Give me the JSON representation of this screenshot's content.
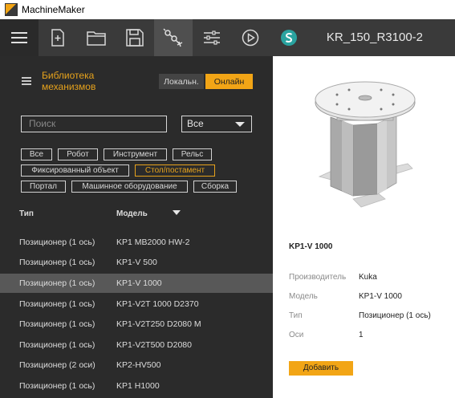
{
  "app": {
    "title": "MachineMaker"
  },
  "toolbar": {
    "buttons": [
      {
        "icon": "menu-icon"
      },
      {
        "icon": "new-document-icon"
      },
      {
        "icon": "open-folder-icon"
      },
      {
        "icon": "save-icon"
      },
      {
        "icon": "robot-arm-icon"
      },
      {
        "icon": "sliders-icon"
      },
      {
        "icon": "play-icon"
      },
      {
        "icon": "s-logo-icon"
      }
    ],
    "machine_name": "KR_150_R3100-2",
    "accent": "#f2a516"
  },
  "library": {
    "title": "Библиотека механизмов",
    "local_label": "Локальн.",
    "online_label": "Онлайн",
    "search_placeholder": "Поиск",
    "select_value": "Все",
    "chips": [
      "Все",
      "Робот",
      "Инструмент",
      "Рельс",
      "Фиксированный объект",
      "Стол/постамент",
      "Портал",
      "Машинное оборудование",
      "Сборка"
    ],
    "selected_chip": "Стол/постамент",
    "columns": {
      "type": "Тип",
      "model": "Модель"
    },
    "rows": [
      {
        "type": "Позиционер (1 ось)",
        "model": "KP1 MB2000 HW-2"
      },
      {
        "type": "Позиционер (1 ось)",
        "model": "KP1-V 500"
      },
      {
        "type": "Позиционер (1 ось)",
        "model": "KP1-V 1000"
      },
      {
        "type": "Позиционер (1 ось)",
        "model": "KP1-V2T 1000 D2370"
      },
      {
        "type": "Позиционер (1 ось)",
        "model": "KP1-V2T250 D2080 M"
      },
      {
        "type": "Позиционер (1 ось)",
        "model": "KP1-V2T500 D2080"
      },
      {
        "type": "Позиционер (2 оси)",
        "model": "KP2-HV500"
      },
      {
        "type": "Позиционер (1 ось)",
        "model": "KP1 H1000"
      }
    ],
    "selected_row": 2
  },
  "details": {
    "model_title": "KP1-V 1000",
    "props": [
      {
        "label": "Производитель",
        "value": "Kuka"
      },
      {
        "label": "Модель",
        "value": "KP1-V 1000"
      },
      {
        "label": "Тип",
        "value": "Позиционер (1 ось)"
      },
      {
        "label": "Оси",
        "value": "1"
      }
    ],
    "add_label": "Добавить"
  }
}
